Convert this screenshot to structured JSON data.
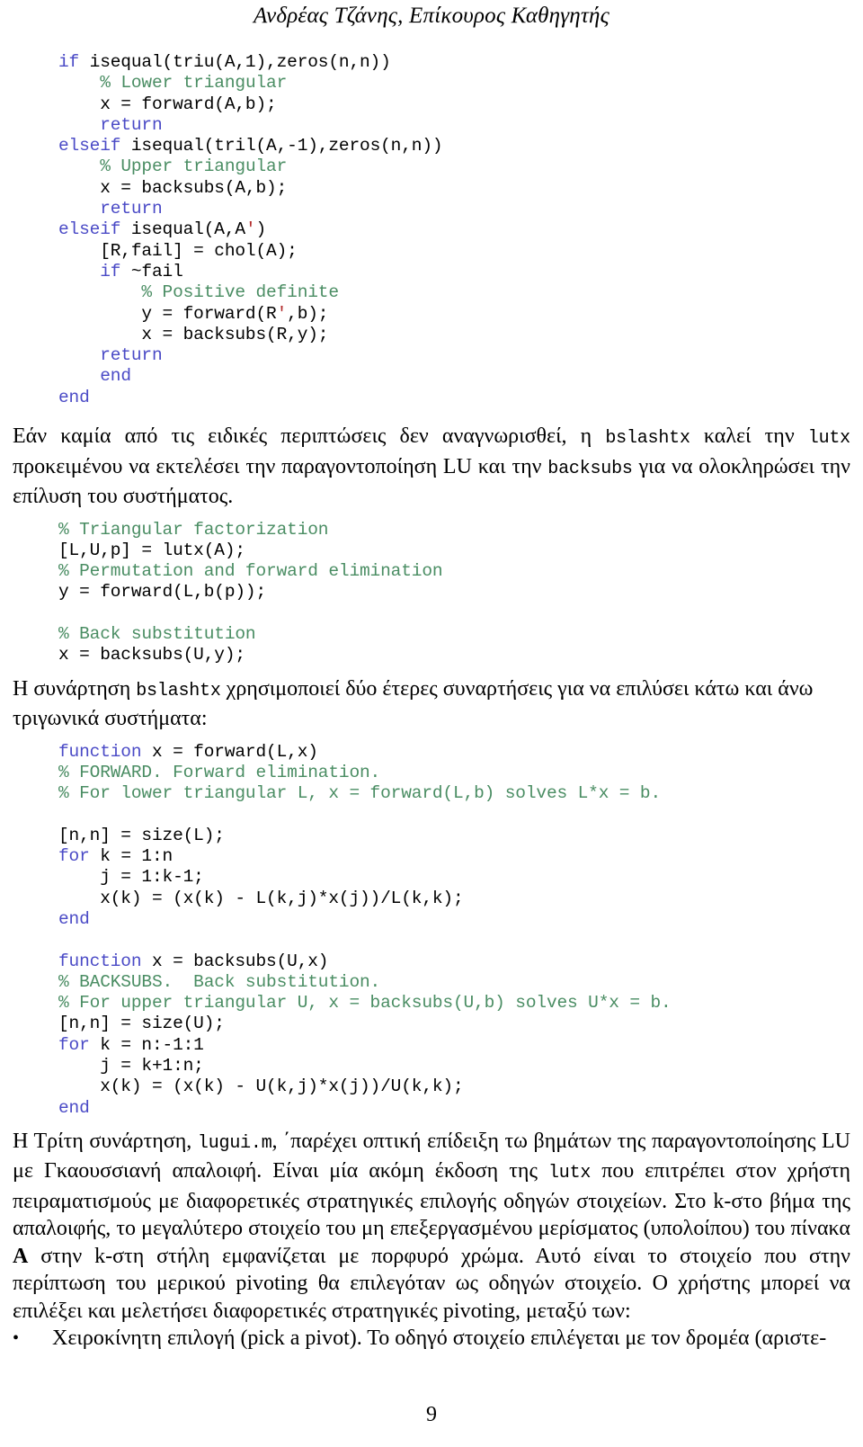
{
  "header": {
    "running_title": "Ανδρέας Τζάνης, Επίκουρος Καθηγητής"
  },
  "footer": {
    "page_number": "9"
  },
  "colors": {
    "keyword": "#4a4ac6",
    "comment": "#4a8d63",
    "plain": "#000000",
    "transpose_quote": "#b32d2d",
    "background": "#ffffff",
    "text": "#000000"
  },
  "code_blocks": {
    "bslashtx_special_cases": {
      "lines": [
        [
          {
            "t": "if ",
            "c": "kw"
          },
          {
            "t": "isequal(triu(A,1),zeros(n,n))",
            "c": "pl"
          }
        ],
        [
          {
            "t": "    ",
            "c": "pl"
          },
          {
            "t": "% Lower triangular",
            "c": "cm"
          }
        ],
        [
          {
            "t": "    x = forward(A,b);",
            "c": "pl"
          }
        ],
        [
          {
            "t": "    ",
            "c": "pl"
          },
          {
            "t": "return",
            "c": "kw"
          }
        ],
        [
          {
            "t": "elseif ",
            "c": "kw"
          },
          {
            "t": "isequal(tril(A,-1),zeros(n,n))",
            "c": "pl"
          }
        ],
        [
          {
            "t": "    ",
            "c": "pl"
          },
          {
            "t": "% Upper triangular",
            "c": "cm"
          }
        ],
        [
          {
            "t": "    x = backsubs(A,b);",
            "c": "pl"
          }
        ],
        [
          {
            "t": "    ",
            "c": "pl"
          },
          {
            "t": "return",
            "c": "kw"
          }
        ],
        [
          {
            "t": "elseif ",
            "c": "kw"
          },
          {
            "t": "isequal(A,A",
            "c": "pl"
          },
          {
            "t": "'",
            "c": "tr"
          },
          {
            "t": ")",
            "c": "pl"
          }
        ],
        [
          {
            "t": "    [R,fail] = chol(A);",
            "c": "pl"
          }
        ],
        [
          {
            "t": "    ",
            "c": "pl"
          },
          {
            "t": "if ",
            "c": "kw"
          },
          {
            "t": "~fail",
            "c": "pl"
          }
        ],
        [
          {
            "t": "        ",
            "c": "pl"
          },
          {
            "t": "% Positive definite",
            "c": "cm"
          }
        ],
        [
          {
            "t": "        y = forward(R",
            "c": "pl"
          },
          {
            "t": "'",
            "c": "tr"
          },
          {
            "t": ",b);",
            "c": "pl"
          }
        ],
        [
          {
            "t": "        x = backsubs(R,y);",
            "c": "pl"
          }
        ],
        [
          {
            "t": "    ",
            "c": "pl"
          },
          {
            "t": "return",
            "c": "kw"
          }
        ],
        [
          {
            "t": "    ",
            "c": "pl"
          },
          {
            "t": "end",
            "c": "kw"
          }
        ],
        [
          {
            "t": "end",
            "c": "kw"
          }
        ]
      ]
    },
    "lu_factorization": {
      "lines": [
        [
          {
            "t": "% Triangular factorization",
            "c": "cm"
          }
        ],
        [
          {
            "t": "[L,U,p] = lutx(A);",
            "c": "pl"
          }
        ],
        [
          {
            "t": "% Permutation and forward elimination",
            "c": "cm"
          }
        ],
        [
          {
            "t": "y = forward(L,b(p));",
            "c": "pl"
          }
        ],
        [
          {
            "t": "",
            "c": "pl"
          }
        ],
        [
          {
            "t": "% Back substitution",
            "c": "cm"
          }
        ],
        [
          {
            "t": "x = backsubs(U,y);",
            "c": "pl"
          }
        ]
      ]
    },
    "forward_and_backsubs": {
      "lines": [
        [
          {
            "t": "function ",
            "c": "kw"
          },
          {
            "t": "x = forward(L,x)",
            "c": "pl"
          }
        ],
        [
          {
            "t": "% FORWARD. Forward elimination.",
            "c": "cm"
          }
        ],
        [
          {
            "t": "% For lower triangular L, x = forward(L,b) solves L*x = b.",
            "c": "cm"
          }
        ],
        [
          {
            "t": "",
            "c": "pl"
          }
        ],
        [
          {
            "t": "[n,n] = size(L);",
            "c": "pl"
          }
        ],
        [
          {
            "t": "for ",
            "c": "kw"
          },
          {
            "t": "k = 1:n",
            "c": "pl"
          }
        ],
        [
          {
            "t": "    j = 1:k-1;",
            "c": "pl"
          }
        ],
        [
          {
            "t": "    x(k) = (x(k) - L(k,j)*x(j))/L(k,k);",
            "c": "pl"
          }
        ],
        [
          {
            "t": "end",
            "c": "kw"
          }
        ],
        [
          {
            "t": "",
            "c": "pl"
          }
        ],
        [
          {
            "t": "function ",
            "c": "kw"
          },
          {
            "t": "x = backsubs(U,x)",
            "c": "pl"
          }
        ],
        [
          {
            "t": "% BACKSUBS.  Back substitution.",
            "c": "cm"
          }
        ],
        [
          {
            "t": "% For upper triangular U, x = backsubs(U,b) solves U*x = b.",
            "c": "cm"
          }
        ],
        [
          {
            "t": "[n,n] = size(U);",
            "c": "pl"
          }
        ],
        [
          {
            "t": "for ",
            "c": "kw"
          },
          {
            "t": "k = n:-1:1",
            "c": "pl"
          }
        ],
        [
          {
            "t": "    j = k+1:n;",
            "c": "pl"
          }
        ],
        [
          {
            "t": "    x(k) = (x(k) - U(k,j)*x(j))/U(k,k);",
            "c": "pl"
          }
        ],
        [
          {
            "t": "end",
            "c": "kw"
          }
        ]
      ]
    }
  },
  "paragraphs": {
    "p1": {
      "runs": [
        {
          "t": "Εάν καμία από τις ειδικές περιπτώσεις δεν αναγνωρισθεί, η ",
          "k": "text"
        },
        {
          "t": "bslashtx",
          "k": "code"
        },
        {
          "t": " καλεί την ",
          "k": "text"
        },
        {
          "t": "lutx",
          "k": "code"
        },
        {
          "t": " προκειμένου να εκτελέσει την παραγοντοποίηση LU και την ",
          "k": "text"
        },
        {
          "t": "backsubs",
          "k": "code"
        },
        {
          "t": " για να ολοκληρώσει την επίλυση του συστήματος.",
          "k": "text"
        }
      ]
    },
    "p2": {
      "runs": [
        {
          "t": "Η συνάρτηση ",
          "k": "text"
        },
        {
          "t": "bslashtx",
          "k": "code"
        },
        {
          "t": " χρησιμοποιεί δύο έτερες συναρτήσεις για να επιλύσει κάτω και άνω τριγωνικά συστήματα:",
          "k": "text"
        }
      ]
    },
    "p3": {
      "runs": [
        {
          "t": "Η Τρίτη συνάρτηση, ",
          "k": "text"
        },
        {
          "t": "lugui.m",
          "k": "code"
        },
        {
          "t": ", ΄παρέχει οπτική επίδειξη τω βημάτων της παραγοντοποίησης LU με Γκαουσσιανή απαλοιφή. Είναι μία ακόμη έκδοση της ",
          "k": "text"
        },
        {
          "t": "lutx",
          "k": "code"
        },
        {
          "t": " που επιτρέπει στον χρήστη πειραματισμούς με διαφορετικές στρατηγικές επιλογής οδηγών στοιχείων. Στο k-στο βήμα της απαλοιφής, το μεγαλύτερο στοιχείο του μη επεξεργασμένου μερίσματος (υπολοίπου) του πίνακα ",
          "k": "text"
        },
        {
          "t": "A",
          "k": "bold"
        },
        {
          "t": " στην k-στη στήλη εμφανίζεται με πορφυρό χρώμα. Αυτό είναι το στοιχείο που στην περίπτωση του μερικού pivoting θα επιλεγόταν ως οδηγών στοιχείο. Ο χρήστης μπορεί να επιλέξει και μελετήσει διαφορετικές στρατηγικές pivoting, μεταξύ των:",
          "k": "text"
        }
      ]
    }
  },
  "bullets": [
    {
      "marker": "•",
      "runs": [
        {
          "t": "Χειροκίνητη επιλογή (pick a pivot). Το οδηγό στοιχείο επιλέγεται με τον δρομέα (αριστε-",
          "k": "text"
        }
      ]
    }
  ]
}
